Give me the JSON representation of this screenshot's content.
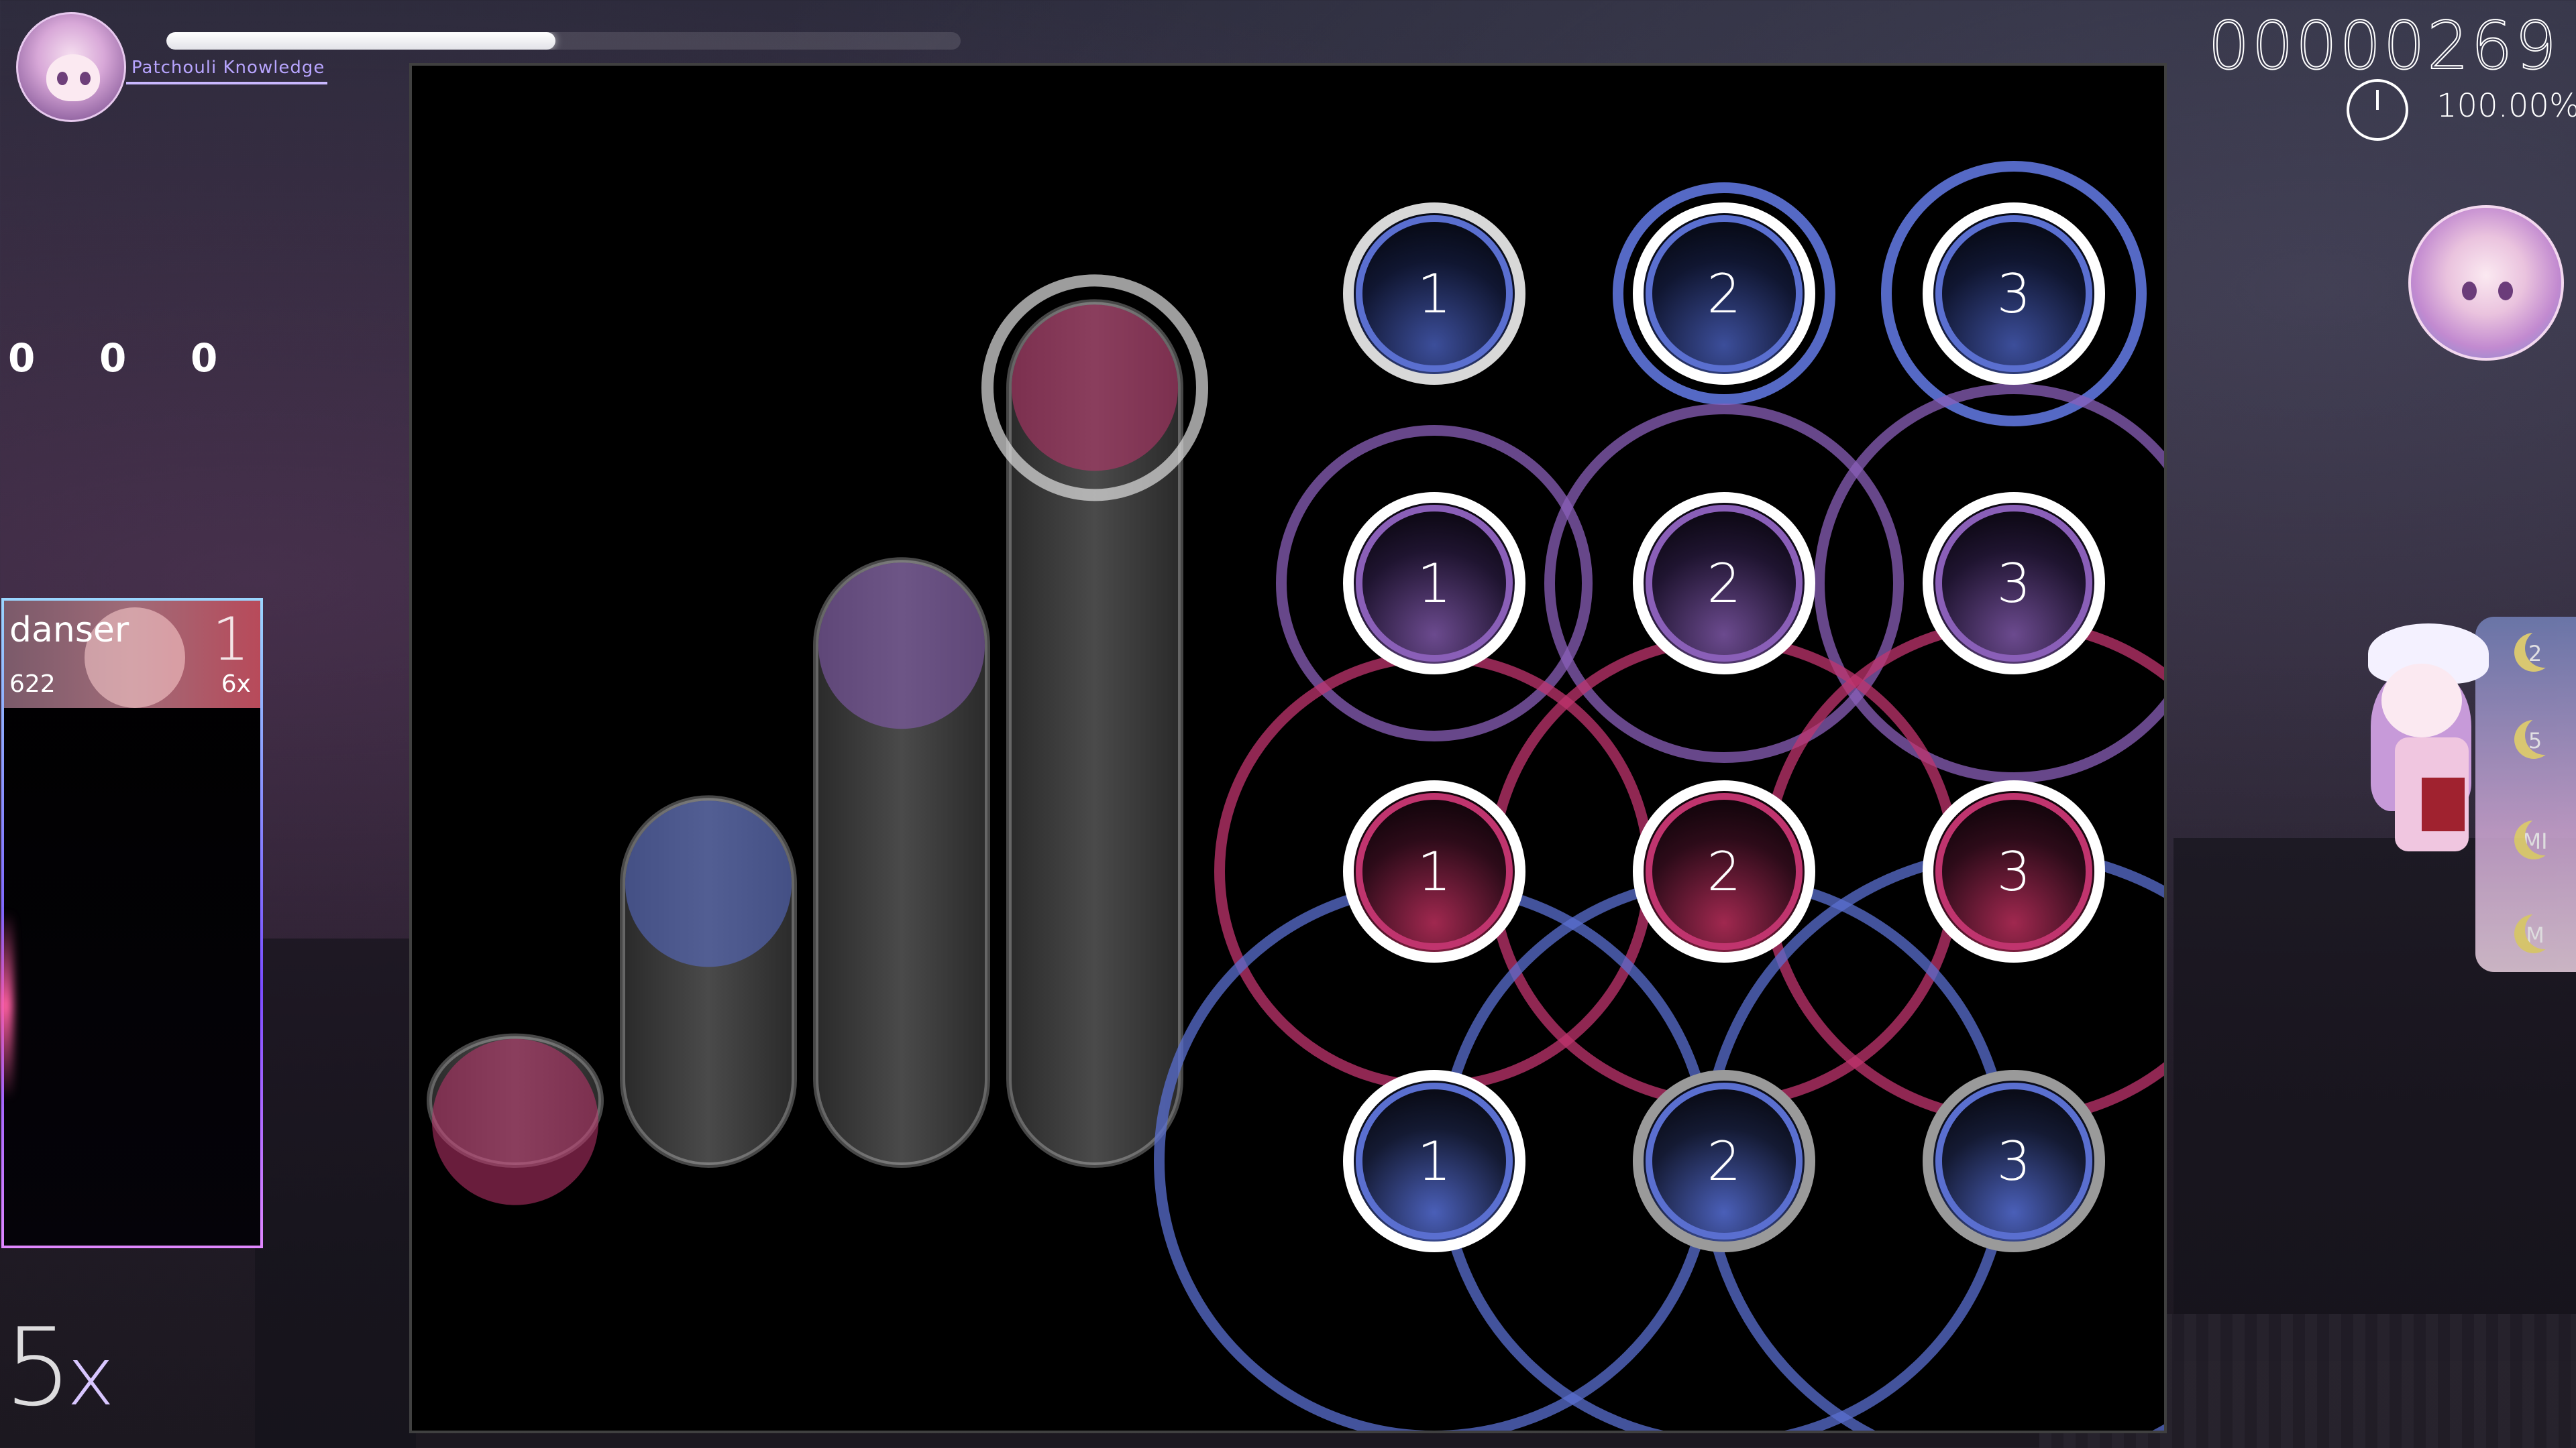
{
  "hud": {
    "player_name": "Patchouli Knowledge",
    "health_fraction": 0.49
  },
  "key_counters": [
    "0",
    "0",
    "0"
  ],
  "leaderboard": {
    "name": "danser",
    "score": "622",
    "rank": "1",
    "combo": "6x"
  },
  "combo": {
    "count": "5",
    "suffix": "x"
  },
  "score": "00000269",
  "accuracy": "100.00%",
  "mods": [
    "2",
    "5",
    "MI",
    "M"
  ],
  "colors": {
    "blue": "#5a6fd0",
    "purple": "#8a5fb8",
    "pink": "#c0346e",
    "gray": "#b8b8b8",
    "accent_name": "#b8a5ff"
  },
  "columns": [
    {
      "color": "pink",
      "cap_level": 0.13
    },
    {
      "color": "blue",
      "cap_level": 0.37
    },
    {
      "color": "purple",
      "cap_level": 0.61
    },
    {
      "color": "pink",
      "cap_level": 0.87
    }
  ],
  "circle_rows": [
    {
      "color": "gray-blue",
      "labels": [
        "1",
        "2",
        "3"
      ],
      "approach": [
        0,
        1,
        1
      ]
    },
    {
      "color": "purple",
      "labels": [
        "1",
        "2",
        "3"
      ],
      "approach": [
        1,
        1,
        1
      ]
    },
    {
      "color": "pink",
      "labels": [
        "1",
        "2",
        "3"
      ],
      "approach": [
        1,
        1,
        1
      ]
    },
    {
      "color": "blue",
      "labels": [
        "1",
        "2",
        "3"
      ],
      "approach": [
        1,
        1,
        1
      ]
    }
  ]
}
